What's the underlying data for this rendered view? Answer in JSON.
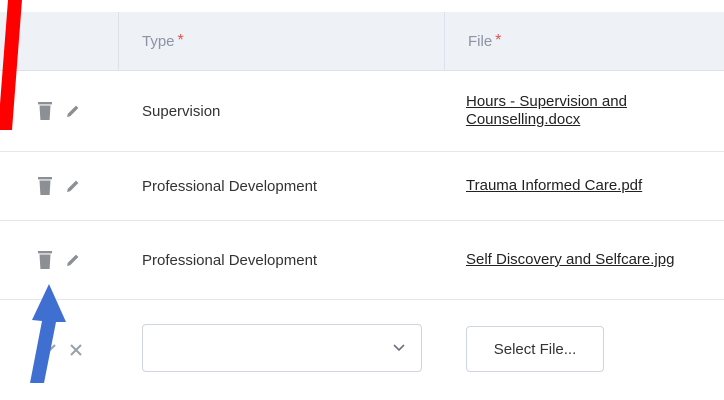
{
  "table": {
    "headers": {
      "type_label": "Type",
      "file_label": "File",
      "required_marker": "*"
    },
    "rows": [
      {
        "type": "Supervision",
        "file": "Hours - Supervision and Counselling.docx"
      },
      {
        "type": "Professional Development",
        "file": "Trauma Informed Care.pdf"
      },
      {
        "type": "Professional Development",
        "file": "Self Discovery and Selfcare.jpg"
      }
    ],
    "new_row": {
      "type_value": "",
      "select_file_label": "Select File..."
    }
  },
  "colors": {
    "header_bg": "#eef1f6",
    "header_text": "#8a94a3",
    "required": "#e05353",
    "icon": "#8c8f94",
    "annotation_red": "#ff0000",
    "annotation_blue": "#3f6fd0"
  },
  "icons": [
    "trash-icon",
    "pencil-icon",
    "check-icon",
    "close-icon",
    "chevron-down-icon"
  ]
}
